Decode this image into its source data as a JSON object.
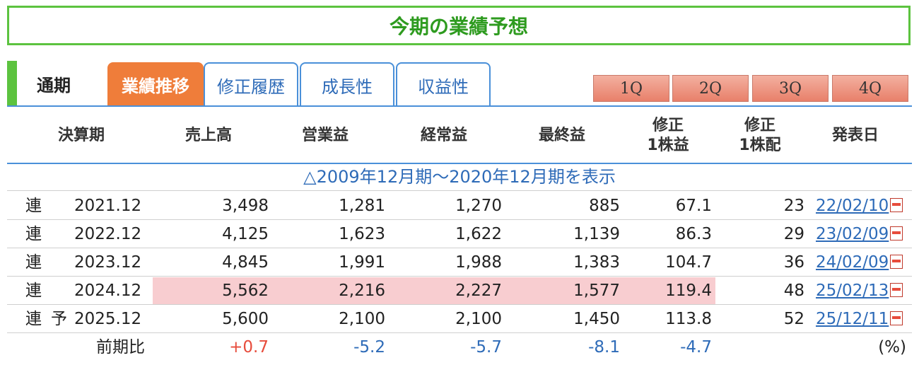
{
  "title": "今期の業績予想",
  "tabs": {
    "static": "通期",
    "items": [
      {
        "label": "業績推移",
        "active": true
      },
      {
        "label": "修正履歴",
        "active": false
      },
      {
        "label": "成長性",
        "active": false
      },
      {
        "label": "収益性",
        "active": false
      }
    ],
    "quarters": [
      "1Q",
      "2Q",
      "3Q",
      "4Q"
    ]
  },
  "headers": {
    "period": "決算期",
    "sales": "売上高",
    "operating": "営業益",
    "ordinary": "経常益",
    "net": "最終益",
    "eps_line1": "修正",
    "eps_line2": "1株益",
    "div_line1": "修正",
    "div_line2": "1株配",
    "date": "発表日"
  },
  "toggle_link": "△2009年12月期～2020年12月期を表示",
  "rows": [
    {
      "type": "連",
      "forecast": "",
      "period": "2021.12",
      "sales": "3,498",
      "operating": "1,281",
      "ordinary": "1,270",
      "net": "885",
      "eps": "67.1",
      "div": "23",
      "date": "22/02/10"
    },
    {
      "type": "連",
      "forecast": "",
      "period": "2022.12",
      "sales": "4,125",
      "operating": "1,623",
      "ordinary": "1,622",
      "net": "1,139",
      "eps": "86.3",
      "div": "29",
      "date": "23/02/09"
    },
    {
      "type": "連",
      "forecast": "",
      "period": "2023.12",
      "sales": "4,845",
      "operating": "1,991",
      "ordinary": "1,988",
      "net": "1,383",
      "eps": "104.7",
      "div": "36",
      "date": "24/02/09"
    },
    {
      "type": "連",
      "forecast": "",
      "period": "2024.12",
      "sales": "5,562",
      "operating": "2,216",
      "ordinary": "2,227",
      "net": "1,577",
      "eps": "119.4",
      "div": "48",
      "date": "25/02/13"
    },
    {
      "type": "連",
      "forecast": "予",
      "period": "2025.12",
      "sales": "5,600",
      "operating": "2,100",
      "ordinary": "2,100",
      "net": "1,450",
      "eps": "113.8",
      "div": "52",
      "date": "25/12/11"
    }
  ],
  "change_row": {
    "label": "前期比",
    "sales": "+0.7",
    "operating": "-5.2",
    "ordinary": "-5.7",
    "net": "-8.1",
    "eps": "-4.7",
    "unit": "(%)"
  },
  "colors": {
    "green": "#5cc33f",
    "orange": "#ef7d3a",
    "blue": "#2e6bb8",
    "highlight": "#f8cdd0",
    "positive": "#e74c3c"
  }
}
